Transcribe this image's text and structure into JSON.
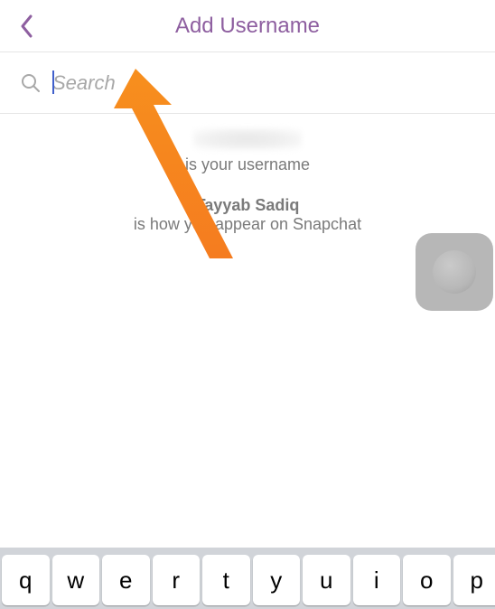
{
  "header": {
    "title": "Add Username"
  },
  "search": {
    "placeholder": "Search",
    "value": ""
  },
  "profile": {
    "username_label": "is your username",
    "display_name": "Tayyab Sadiq",
    "display_name_label": "is how you appear on Snapchat"
  },
  "keyboard": {
    "row1": [
      "q",
      "w",
      "e",
      "r",
      "t",
      "y",
      "u",
      "i",
      "o",
      "p"
    ]
  },
  "colors": {
    "accent": "#8e5fa0",
    "arrow": "#f57c1f"
  }
}
